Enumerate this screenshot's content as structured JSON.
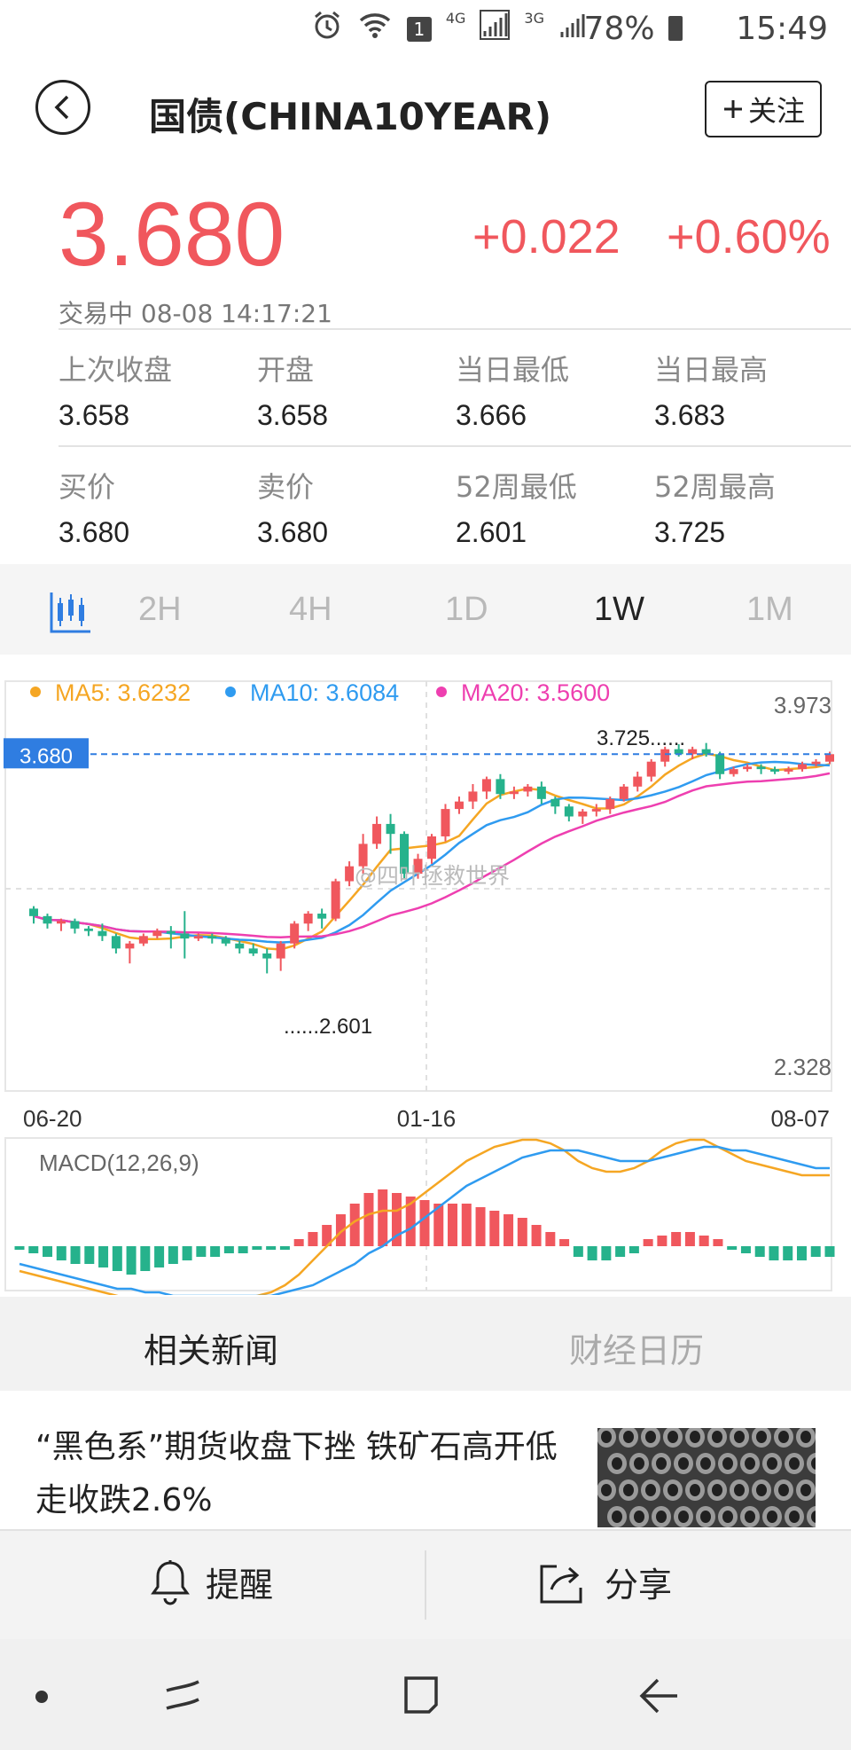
{
  "status_bar": {
    "signal_4g": "4G",
    "signal_3g": "3G",
    "notification_count": "1",
    "battery": "78%",
    "clock": "15:49",
    "icons": [
      "alarm-icon",
      "wifi-icon",
      "notification-icon",
      "signal-4g-icon",
      "signal-3g-icon",
      "battery-icon"
    ]
  },
  "header": {
    "title": "国债(CHINA10YEAR)",
    "follow_label": "关注",
    "follow_icon": "plus-icon"
  },
  "quote": {
    "price": "3.680",
    "change": "+0.022",
    "change_pct": "+0.60%",
    "status": "交易中 08-08 14:17:21",
    "up_color": "#f0575d"
  },
  "stats": [
    {
      "label": "上次收盘",
      "value": "3.658"
    },
    {
      "label": "开盘",
      "value": "3.658"
    },
    {
      "label": "当日最低",
      "value": "3.666"
    },
    {
      "label": "当日最高",
      "value": "3.683"
    },
    {
      "label": "买价",
      "value": "3.680"
    },
    {
      "label": "卖价",
      "value": "3.680"
    },
    {
      "label": "52周最低",
      "value": "2.601"
    },
    {
      "label": "52周最高",
      "value": "3.725"
    }
  ],
  "period_tabs": {
    "icon": "candlestick-icon",
    "items": [
      "2H",
      "4H",
      "1D",
      "1W",
      "1M"
    ],
    "active": "1W"
  },
  "chart_data": [
    {
      "type": "candlestick",
      "legend": [
        "MA5: 3.6232",
        "MA10: 3.6084",
        "MA20: 3.5600"
      ],
      "legend_colors": [
        "#f5a623",
        "#2f9bf0",
        "#ee3fb0"
      ],
      "current_price_label": "3.680",
      "y_axis_top": "3.973",
      "y_axis_bottom": "2.328",
      "ylim": [
        2.328,
        3.973
      ],
      "high_annotation": "3.725......",
      "low_annotation": "......2.601",
      "x_ticks": [
        "06-20",
        "01-16",
        "08-07"
      ],
      "watermark": "@四叶拯救世界",
      "up_color": "#f0575d",
      "down_color": "#26b28c",
      "candles": [
        [
          3.06,
          3.03,
          3.07,
          3.0
        ],
        [
          3.03,
          3.0,
          3.04,
          2.98
        ],
        [
          3.0,
          3.01,
          3.02,
          2.97
        ],
        [
          3.01,
          2.98,
          3.02,
          2.96
        ],
        [
          2.98,
          2.97,
          2.99,
          2.95
        ],
        [
          2.97,
          2.95,
          3.0,
          2.93
        ],
        [
          2.95,
          2.9,
          2.96,
          2.88
        ],
        [
          2.9,
          2.92,
          2.93,
          2.84
        ],
        [
          2.92,
          2.95,
          2.96,
          2.91
        ],
        [
          2.95,
          2.97,
          2.98,
          2.94
        ],
        [
          2.97,
          2.96,
          2.99,
          2.9
        ],
        [
          2.96,
          2.94,
          3.05,
          2.86
        ],
        [
          2.94,
          2.95,
          2.96,
          2.93
        ],
        [
          2.95,
          2.94,
          2.96,
          2.92
        ],
        [
          2.94,
          2.92,
          2.95,
          2.91
        ],
        [
          2.92,
          2.9,
          2.93,
          2.88
        ],
        [
          2.9,
          2.88,
          2.92,
          2.87
        ],
        [
          2.88,
          2.86,
          2.9,
          2.8
        ],
        [
          2.86,
          2.92,
          2.93,
          2.81
        ],
        [
          2.92,
          3.0,
          3.01,
          2.9
        ],
        [
          3.0,
          3.04,
          3.05,
          2.97
        ],
        [
          3.04,
          3.02,
          3.06,
          2.98
        ],
        [
          3.02,
          3.17,
          3.18,
          3.01
        ],
        [
          3.17,
          3.23,
          3.25,
          3.15
        ],
        [
          3.23,
          3.32,
          3.36,
          3.2
        ],
        [
          3.32,
          3.4,
          3.43,
          3.3
        ],
        [
          3.4,
          3.36,
          3.44,
          3.28
        ],
        [
          3.36,
          3.2,
          3.37,
          3.18
        ],
        [
          3.2,
          3.26,
          3.28,
          3.18
        ],
        [
          3.26,
          3.35,
          3.36,
          3.24
        ],
        [
          3.35,
          3.46,
          3.48,
          3.33
        ],
        [
          3.46,
          3.49,
          3.51,
          3.44
        ],
        [
          3.49,
          3.53,
          3.56,
          3.46
        ],
        [
          3.53,
          3.58,
          3.59,
          3.5
        ],
        [
          3.58,
          3.52,
          3.6,
          3.5
        ],
        [
          3.52,
          3.53,
          3.55,
          3.5
        ],
        [
          3.53,
          3.55,
          3.56,
          3.51
        ],
        [
          3.55,
          3.5,
          3.57,
          3.48
        ],
        [
          3.5,
          3.47,
          3.51,
          3.44
        ],
        [
          3.47,
          3.43,
          3.48,
          3.41
        ],
        [
          3.43,
          3.45,
          3.46,
          3.4
        ],
        [
          3.45,
          3.46,
          3.48,
          3.43
        ],
        [
          3.46,
          3.5,
          3.51,
          3.44
        ],
        [
          3.5,
          3.55,
          3.56,
          3.49
        ],
        [
          3.55,
          3.59,
          3.61,
          3.53
        ],
        [
          3.59,
          3.65,
          3.66,
          3.57
        ],
        [
          3.65,
          3.7,
          3.71,
          3.63
        ],
        [
          3.7,
          3.68,
          3.72,
          3.67
        ],
        [
          3.68,
          3.7,
          3.71,
          3.66
        ],
        [
          3.7,
          3.68,
          3.725,
          3.67
        ],
        [
          3.68,
          3.6,
          3.69,
          3.58
        ],
        [
          3.6,
          3.62,
          3.63,
          3.59
        ],
        [
          3.62,
          3.63,
          3.64,
          3.61
        ],
        [
          3.63,
          3.62,
          3.64,
          3.6
        ],
        [
          3.62,
          3.61,
          3.63,
          3.6
        ],
        [
          3.61,
          3.62,
          3.63,
          3.6
        ],
        [
          3.62,
          3.64,
          3.65,
          3.61
        ],
        [
          3.64,
          3.65,
          3.66,
          3.63
        ],
        [
          3.65,
          3.68,
          3.69,
          3.64
        ]
      ]
    },
    {
      "type": "macd",
      "title": "MACD(12,26,9)",
      "histogram": [
        -0.01,
        -0.02,
        -0.03,
        -0.04,
        -0.05,
        -0.05,
        -0.06,
        -0.07,
        -0.08,
        -0.07,
        -0.06,
        -0.05,
        -0.04,
        -0.03,
        -0.03,
        -0.02,
        -0.02,
        -0.01,
        -0.01,
        -0.01,
        0.02,
        0.04,
        0.06,
        0.09,
        0.12,
        0.15,
        0.16,
        0.15,
        0.14,
        0.13,
        0.12,
        0.12,
        0.12,
        0.11,
        0.1,
        0.09,
        0.08,
        0.06,
        0.04,
        0.02,
        -0.03,
        -0.04,
        -0.04,
        -0.03,
        -0.02,
        0.02,
        0.03,
        0.04,
        0.04,
        0.03,
        0.02,
        -0.01,
        -0.02,
        -0.03,
        -0.04,
        -0.04,
        -0.04,
        -0.03,
        -0.03
      ],
      "dif": [
        -0.07,
        -0.08,
        -0.09,
        -0.1,
        -0.11,
        -0.12,
        -0.13,
        -0.14,
        -0.15,
        -0.15,
        -0.15,
        -0.15,
        -0.15,
        -0.15,
        -0.15,
        -0.15,
        -0.15,
        -0.14,
        -0.13,
        -0.11,
        -0.08,
        -0.04,
        0.0,
        0.04,
        0.07,
        0.09,
        0.1,
        0.1,
        0.12,
        0.15,
        0.18,
        0.21,
        0.24,
        0.26,
        0.28,
        0.29,
        0.3,
        0.3,
        0.29,
        0.27,
        0.24,
        0.22,
        0.21,
        0.21,
        0.22,
        0.24,
        0.27,
        0.29,
        0.3,
        0.3,
        0.28,
        0.26,
        0.24,
        0.23,
        0.22,
        0.21,
        0.2,
        0.2,
        0.2
      ],
      "dea": [
        -0.05,
        -0.06,
        -0.07,
        -0.08,
        -0.09,
        -0.1,
        -0.11,
        -0.12,
        -0.12,
        -0.13,
        -0.13,
        -0.14,
        -0.14,
        -0.14,
        -0.14,
        -0.14,
        -0.14,
        -0.14,
        -0.14,
        -0.13,
        -0.12,
        -0.11,
        -0.09,
        -0.07,
        -0.05,
        -0.02,
        0.0,
        0.03,
        0.05,
        0.08,
        0.11,
        0.14,
        0.17,
        0.19,
        0.21,
        0.23,
        0.25,
        0.26,
        0.27,
        0.27,
        0.27,
        0.26,
        0.25,
        0.24,
        0.24,
        0.24,
        0.25,
        0.26,
        0.27,
        0.28,
        0.28,
        0.27,
        0.27,
        0.26,
        0.25,
        0.24,
        0.23,
        0.22,
        0.22
      ]
    }
  ],
  "news": {
    "tabs": [
      "相关新闻",
      "财经日历"
    ],
    "active_tab": "相关新闻",
    "items": [
      {
        "title": "“黑色系”期货收盘下挫 铁矿石高开低走收跌2.6%"
      }
    ]
  },
  "action_bar": {
    "remind_label": "提醒",
    "share_label": "分享"
  }
}
